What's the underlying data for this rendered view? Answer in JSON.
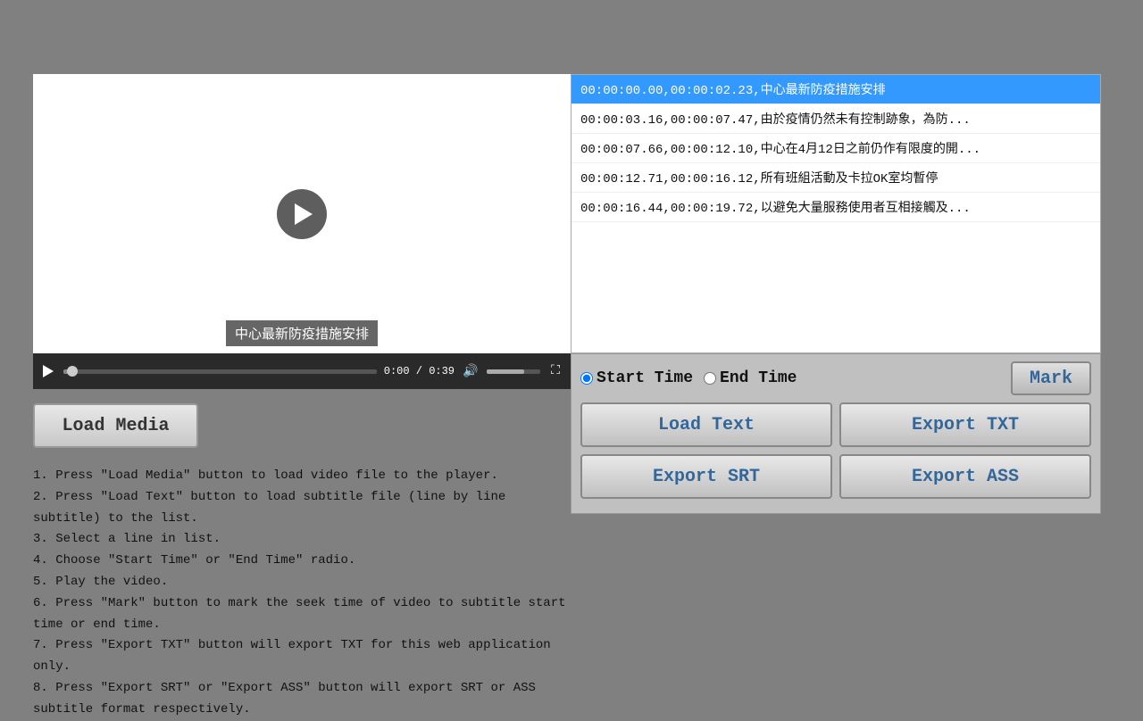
{
  "app": {
    "background": "#808080"
  },
  "video": {
    "current_time": "0:00",
    "total_time": "0:39",
    "subtitle_overlay": "中心最新防疫措施安排",
    "play_label": "Play",
    "mute_label": "Mute",
    "fullscreen_label": "Fullscreen"
  },
  "buttons": {
    "load_media": "Load Media",
    "load_text": "Load Text",
    "export_txt": "Export TXT",
    "export_srt": "Export SRT",
    "export_ass": "Export ASS",
    "mark": "Mark"
  },
  "radio": {
    "start_time_label": "Start Time",
    "end_time_label": "End Time"
  },
  "subtitle_list": [
    {
      "id": 0,
      "text": "00:00:00.00,00:00:02.23,中心最新防疫措施安排",
      "selected": true
    },
    {
      "id": 1,
      "text": "00:00:03.16,00:00:07.47,由於疫情仍然未有控制跡象，為防...",
      "selected": false
    },
    {
      "id": 2,
      "text": "00:00:07.66,00:00:12.10,中心在4月12日之前仍作有限度的開...",
      "selected": false
    },
    {
      "id": 3,
      "text": "00:00:12.71,00:00:16.12,所有班組活動及卡拉OK室均暫停",
      "selected": false
    },
    {
      "id": 4,
      "text": "00:00:16.44,00:00:19.72,以避免大量服務使用者互相接觸及...",
      "selected": false
    }
  ],
  "instructions": [
    "1. Press \"Load Media\" button to load video file to the player.",
    "2. Press \"Load Text\" button to load subtitle file (line by line subtitle) to the list.",
    "3. Select a line in list.",
    "4. Choose \"Start Time\" or \"End Time\" radio.",
    "5. Play the video.",
    "6. Press \"Mark\" button to mark the seek time of video to subtitle start time or end time.",
    "7. Press \"Export TXT\" button will export TXT for this web application only.",
    "8. Press \"Export SRT\" or \"Export ASS\" button will export SRT or ASS subtitle format respectively."
  ]
}
